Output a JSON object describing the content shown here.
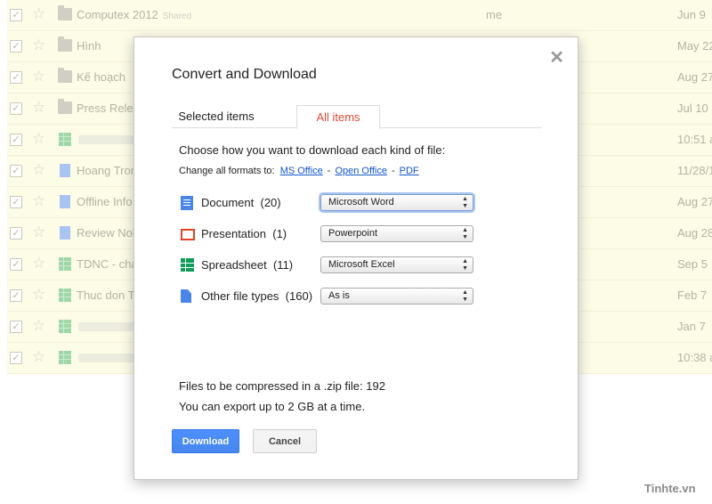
{
  "file_list": {
    "rows": [
      {
        "type": "folder",
        "name": "Computex 2012",
        "tag": "Shared",
        "owner": "me",
        "date": "Jun 9"
      },
      {
        "type": "folder",
        "name": "Hình",
        "tag": "",
        "owner": "",
        "date": "May 22"
      },
      {
        "type": "folder",
        "name": "Kế hoạch",
        "tag": "",
        "owner": "",
        "date": "Aug 27"
      },
      {
        "type": "folder",
        "name": "Press Rele",
        "tag": "",
        "owner": "",
        "date": "Jul 10"
      },
      {
        "type": "sheet",
        "name": "",
        "tag": "",
        "owner": "",
        "date": "10:51 a"
      },
      {
        "type": "doc",
        "name": "Hoang Tron",
        "tag": "",
        "owner": "",
        "date": "11/28/1"
      },
      {
        "type": "doc",
        "name": "Offline Info",
        "tag": "",
        "owner": "",
        "date": "Aug 27"
      },
      {
        "type": "doc",
        "name": "Review Nok",
        "tag": "",
        "owner": "",
        "date": "Aug 28"
      },
      {
        "type": "sheet",
        "name": "TDNC - chá",
        "tag": "",
        "owner": "",
        "date": "Sep 5"
      },
      {
        "type": "sheet",
        "name": "Thuc don T",
        "tag": "",
        "owner": "",
        "date": "Feb 7"
      },
      {
        "type": "sheet",
        "name": "",
        "tag": "",
        "owner": "",
        "date": "Jan 7"
      },
      {
        "type": "sheet",
        "name": "",
        "tag": "",
        "owner": "",
        "date": "10:38 a"
      }
    ]
  },
  "dialog": {
    "title": "Convert and Download",
    "close_glyph": "✕",
    "tabs": [
      {
        "label": "Selected items",
        "active": false
      },
      {
        "label": "All items",
        "active": true
      }
    ],
    "intro": "Choose how you want to download each kind of file:",
    "change_all": {
      "label": "Change all formats to:",
      "options": [
        "MS Office",
        "Open Office",
        "PDF"
      ],
      "separator": "-"
    },
    "file_types": [
      {
        "icon": "document-icon",
        "label": "Document",
        "count": "(20)",
        "format": "Microsoft Word",
        "focused": true
      },
      {
        "icon": "presentation-icon",
        "label": "Presentation",
        "count": "(1)",
        "format": "Powerpoint",
        "focused": false
      },
      {
        "icon": "spreadsheet-icon",
        "label": "Spreadsheet",
        "count": "(11)",
        "format": "Microsoft Excel",
        "focused": false
      },
      {
        "icon": "file-icon",
        "label": "Other file types",
        "count": "(160)",
        "format": "As is",
        "focused": false
      }
    ],
    "compressed_info": "Files to be compressed in a .zip file: 192",
    "export_limit": "You can export up to 2 GB at a time.",
    "download_label": "Download",
    "cancel_label": "Cancel"
  },
  "watermark": "Tinhte.vn",
  "colors": {
    "accent_blue": "#4d90fe",
    "active_tab_red": "#dd4b39",
    "link_blue": "#1155cc",
    "row_highlight": "#fdfce7"
  }
}
